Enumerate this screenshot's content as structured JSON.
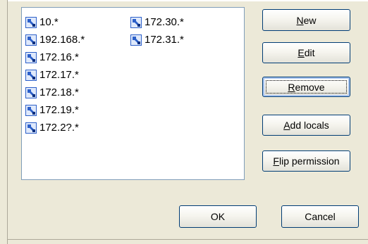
{
  "list": {
    "column1": [
      {
        "label": "10.*",
        "icon": "network-host-icon"
      },
      {
        "label": "192.168.*",
        "icon": "network-host-icon"
      },
      {
        "label": "172.16.*",
        "icon": "network-host-icon"
      },
      {
        "label": "172.17.*",
        "icon": "network-host-icon"
      },
      {
        "label": "172.18.*",
        "icon": "network-host-icon"
      },
      {
        "label": "172.19.*",
        "icon": "network-host-icon"
      },
      {
        "label": "172.2?.*",
        "icon": "network-host-icon"
      }
    ],
    "column2": [
      {
        "label": "172.30.*",
        "icon": "network-host-icon"
      },
      {
        "label": "172.31.*",
        "icon": "network-host-icon"
      }
    ]
  },
  "buttons": {
    "new": {
      "mnemonic": "N",
      "rest": "ew"
    },
    "edit": {
      "mnemonic": "E",
      "rest": "dit"
    },
    "remove": {
      "mnemonic": "R",
      "rest": "emove"
    },
    "add_locals": {
      "mnemonic": "A",
      "rest": "dd locals"
    },
    "flip_permission": {
      "mnemonic": "F",
      "rest": "lip permission"
    },
    "ok": "OK",
    "cancel": "Cancel"
  },
  "colors": {
    "dialog_bg": "#ece9d8",
    "list_border": "#7f9db9",
    "button_border": "#003c74",
    "icon_blue": "#2b5fc9"
  }
}
